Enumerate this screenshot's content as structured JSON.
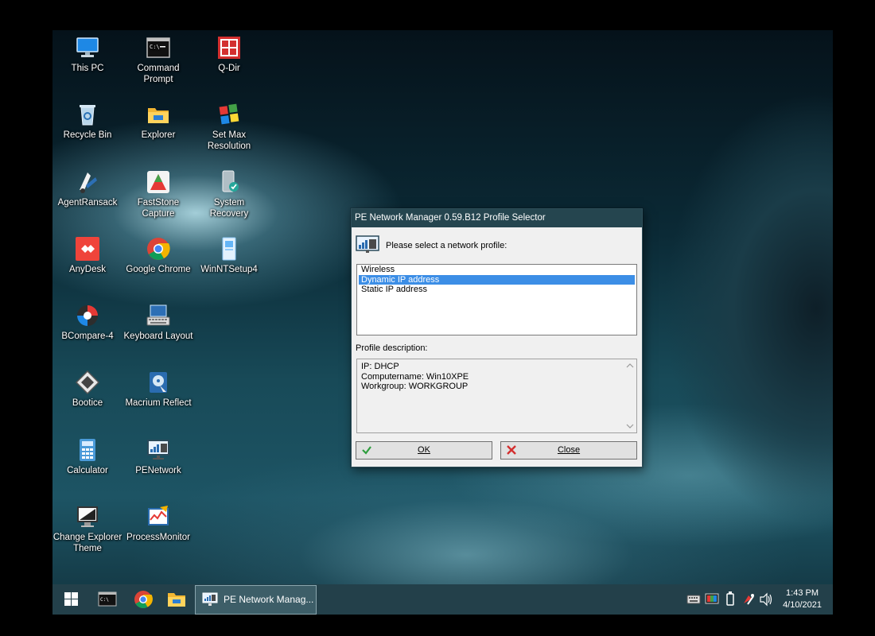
{
  "desktop": {
    "icons": [
      {
        "label": "This PC"
      },
      {
        "label": "Command Prompt"
      },
      {
        "label": "Q-Dir"
      },
      {
        "label": "Recycle Bin"
      },
      {
        "label": "Explorer"
      },
      {
        "label": "Set Max Resolution"
      },
      {
        "label": "AgentRansack"
      },
      {
        "label": "FastStone Capture"
      },
      {
        "label": "System Recovery"
      },
      {
        "label": "AnyDesk"
      },
      {
        "label": "Google Chrome"
      },
      {
        "label": "WinNTSetup4"
      },
      {
        "label": "BCompare-4"
      },
      {
        "label": "Keyboard Layout"
      },
      {
        "label": "Bootice"
      },
      {
        "label": "Macrium Reflect"
      },
      {
        "label": "Calculator"
      },
      {
        "label": "PENetwork"
      },
      {
        "label": "Change Explorer Theme"
      },
      {
        "label": "ProcessMonitor"
      }
    ]
  },
  "dialog": {
    "title": "PE Network Manager 0.59.B12 Profile Selector",
    "prompt": "Please select a network profile:",
    "profiles": [
      "Wireless",
      "Dynamic IP address",
      "Static IP address"
    ],
    "selected_profile": "Dynamic IP address",
    "description_label": "Profile description:",
    "description_lines": [
      "IP: DHCP",
      "Computername: Win10XPE",
      "Workgroup: WORKGROUP"
    ],
    "ok_label": "OK",
    "close_label": "Close"
  },
  "taskbar": {
    "active_window": "PE Network Manag...",
    "time": "1:43 PM",
    "date": "4/10/2021"
  },
  "colors": {
    "titlebar": "#25454f",
    "taskbar": "#23404a",
    "selection": "#3c8ee6"
  }
}
